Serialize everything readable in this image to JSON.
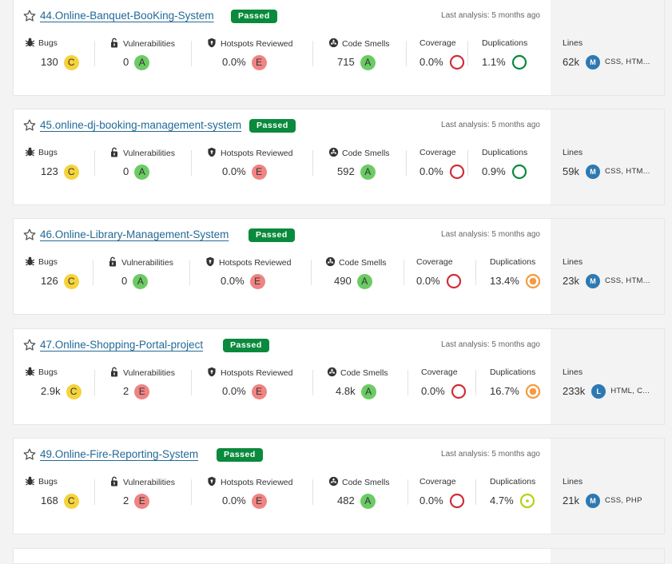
{
  "labels": {
    "bugs": "Bugs",
    "vulnerabilities": "Vulnerabilities",
    "hotspots": "Hotspots Reviewed",
    "code_smells": "Code Smells",
    "coverage": "Coverage",
    "duplications": "Duplications",
    "lines": "Lines"
  },
  "icons": {
    "star": "star-icon",
    "bug": "bug-icon",
    "lock": "lock-icon",
    "shield": "shield-icon",
    "smell": "code-smell-icon"
  },
  "colors": {
    "passed": "#0a8a3c",
    "rating_A": "#6ccb64",
    "rating_C": "#f5d33c",
    "rating_E": "#ef8482",
    "coverage_ring": "#d02f3a",
    "dup_low": "#0a8a3c",
    "dup_mid": "#f59a41",
    "dup_light": "#b0d513",
    "lang": "#2d79b2"
  },
  "projects": [
    {
      "name": "44.Online-Banquet-BooKing-System",
      "status": "Passed",
      "last_analysis": "Last analysis: 5 months ago",
      "bugs": "130",
      "bugs_rating": "C",
      "vulnerabilities": "0",
      "vuln_rating": "A",
      "hotspots": "0.0%",
      "hotspots_rating": "E",
      "code_smells": "715",
      "smells_rating": "A",
      "coverage": "0.0%",
      "duplications": "1.1%",
      "dup_level": "low",
      "lines": "62k",
      "size": "M",
      "languages": "CSS, HTM..."
    },
    {
      "name": "45.online-dj-booking-management-system",
      "status": "Passed",
      "last_analysis": "Last analysis: 5 months ago",
      "bugs": "123",
      "bugs_rating": "C",
      "vulnerabilities": "0",
      "vuln_rating": "A",
      "hotspots": "0.0%",
      "hotspots_rating": "E",
      "code_smells": "592",
      "smells_rating": "A",
      "coverage": "0.0%",
      "duplications": "0.9%",
      "dup_level": "low",
      "lines": "59k",
      "size": "M",
      "languages": "CSS, HTM..."
    },
    {
      "name": "46.Online-Library-Management-System",
      "status": "Passed",
      "last_analysis": "Last analysis: 5 months ago",
      "bugs": "126",
      "bugs_rating": "C",
      "vulnerabilities": "0",
      "vuln_rating": "A",
      "hotspots": "0.0%",
      "hotspots_rating": "E",
      "code_smells": "490",
      "smells_rating": "A",
      "coverage": "0.0%",
      "duplications": "13.4%",
      "dup_level": "mid",
      "lines": "23k",
      "size": "M",
      "languages": "CSS, HTM..."
    },
    {
      "name": "47.Online-Shopping-Portal-project",
      "status": "Passed",
      "last_analysis": "Last analysis: 5 months ago",
      "bugs": "2.9k",
      "bugs_rating": "C",
      "vulnerabilities": "2",
      "vuln_rating": "E",
      "hotspots": "0.0%",
      "hotspots_rating": "E",
      "code_smells": "4.8k",
      "smells_rating": "A",
      "coverage": "0.0%",
      "duplications": "16.7%",
      "dup_level": "mid",
      "lines": "233k",
      "size": "L",
      "languages": "HTML, C..."
    },
    {
      "name": "49.Online-Fire-Reporting-System",
      "status": "Passed",
      "last_analysis": "Last analysis: 5 months ago",
      "bugs": "168",
      "bugs_rating": "C",
      "vulnerabilities": "2",
      "vuln_rating": "E",
      "hotspots": "0.0%",
      "hotspots_rating": "E",
      "code_smells": "482",
      "smells_rating": "A",
      "coverage": "0.0%",
      "duplications": "4.7%",
      "dup_level": "light",
      "lines": "21k",
      "size": "M",
      "languages": "CSS, PHP"
    }
  ]
}
